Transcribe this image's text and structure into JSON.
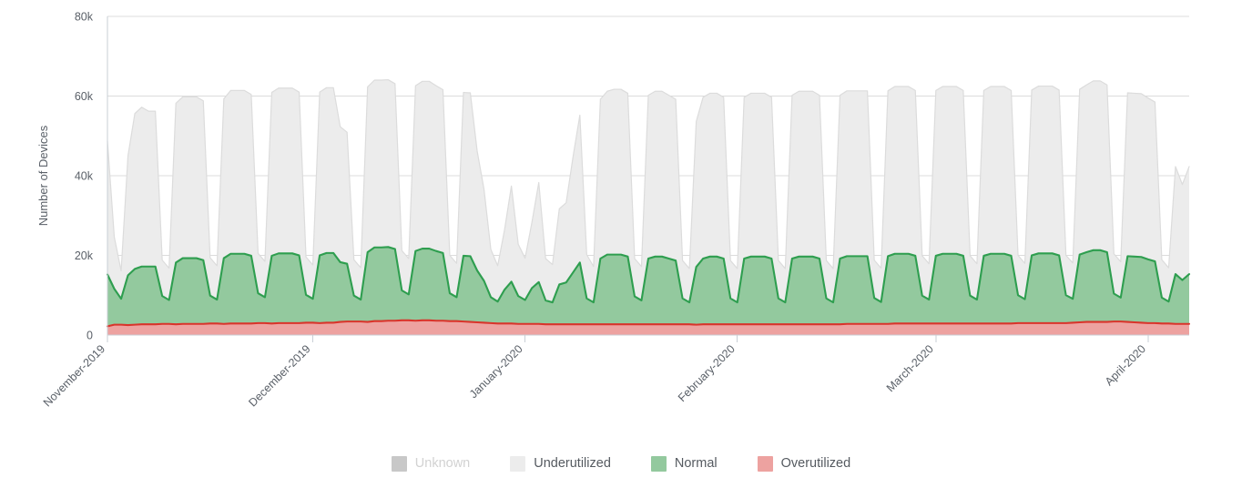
{
  "chart_data": {
    "type": "area",
    "stacked": true,
    "title": "",
    "subtitle": "",
    "xlabel": "",
    "ylabel": "Number of Devices",
    "ylim": [
      0,
      80000
    ],
    "yticks": [
      0,
      20000,
      40000,
      60000,
      80000
    ],
    "ytick_labels": [
      "0",
      "20k",
      "40k",
      "60k",
      "80k"
    ],
    "xtick_labels": [
      "November-2019",
      "December-2019",
      "January-2020",
      "February-2020",
      "March-2020",
      "April-2020"
    ],
    "xtick_rotation_deg": -45,
    "grid": "horizontal",
    "legend_position": "bottom",
    "x_range": [
      "2019-11-01",
      "2020-04-13"
    ],
    "x_interval": "daily",
    "series": [
      {
        "name": "Unknown",
        "fill_color": "#c8c8c8",
        "line_color": "#b4b4b4",
        "visible": false,
        "values": []
      },
      {
        "name": "Underutilized",
        "fill_color": "#ececec",
        "line_color": "#dcdcdc",
        "visible": true,
        "values": [
          33500,
          13000,
          7000,
          30000,
          39000,
          40000,
          39000,
          39000,
          9000,
          8000,
          40000,
          40500,
          40500,
          40500,
          40000,
          9500,
          8500,
          40000,
          41000,
          41000,
          41000,
          40500,
          10000,
          9000,
          41000,
          41500,
          41500,
          41500,
          41000,
          9500,
          8500,
          41000,
          41500,
          41500,
          34000,
          33000,
          9000,
          8000,
          41500,
          42000,
          42000,
          42000,
          41500,
          10000,
          9000,
          41500,
          42000,
          42000,
          41500,
          41000,
          9500,
          8500,
          41000,
          41000,
          30000,
          23000,
          12000,
          9000,
          15000,
          24000,
          13000,
          10500,
          16500,
          25000,
          10500,
          9500,
          19000,
          20000,
          29000,
          37000,
          11000,
          9000,
          40000,
          41000,
          41500,
          41500,
          41000,
          9500,
          8500,
          41000,
          41500,
          41500,
          41000,
          40500,
          9500,
          8500,
          36500,
          40500,
          41000,
          41000,
          40500,
          9500,
          8500,
          40500,
          41000,
          41000,
          41000,
          40500,
          9500,
          8500,
          41000,
          41500,
          41500,
          41500,
          41000,
          9500,
          8500,
          41000,
          41500,
          41500,
          41500,
          41500,
          9500,
          8500,
          41500,
          42000,
          42000,
          42000,
          41500,
          10000,
          9000,
          41500,
          42000,
          42000,
          42000,
          41500,
          10000,
          9000,
          41500,
          42000,
          42000,
          42000,
          41500,
          10000,
          9000,
          41500,
          42000,
          42000,
          42000,
          41500,
          10000,
          9000,
          41500,
          42000,
          42500,
          42500,
          42000,
          10000,
          9000,
          41000,
          41000,
          41000,
          40500,
          40000,
          9500,
          8500,
          27000,
          24000,
          27000
        ]
      },
      {
        "name": "Normal",
        "fill_color": "#93c99e",
        "line_color": "#2e9e4f",
        "visible": true,
        "values": [
          13000,
          9000,
          6500,
          12500,
          14000,
          14500,
          14500,
          14500,
          7000,
          6000,
          15500,
          16500,
          16500,
          16500,
          16000,
          7000,
          6000,
          16500,
          17500,
          17500,
          17500,
          17000,
          7500,
          6500,
          17000,
          17500,
          17500,
          17500,
          17000,
          7000,
          6000,
          17000,
          17500,
          17500,
          15000,
          14500,
          6500,
          5500,
          17500,
          18500,
          18500,
          18500,
          18000,
          7500,
          6500,
          17500,
          18000,
          18000,
          17500,
          17000,
          7000,
          6000,
          16500,
          16500,
          13000,
          10500,
          6500,
          5500,
          8500,
          10500,
          7000,
          6000,
          9000,
          10500,
          6000,
          5500,
          10000,
          10500,
          13000,
          15500,
          6500,
          5500,
          16500,
          17500,
          17500,
          17500,
          17000,
          7000,
          6000,
          16500,
          17000,
          17000,
          16500,
          16000,
          6500,
          5500,
          14500,
          16500,
          17000,
          17000,
          16500,
          6500,
          5500,
          16500,
          17000,
          17000,
          17000,
          16500,
          6500,
          5500,
          16500,
          17000,
          17000,
          17000,
          16500,
          6500,
          5500,
          16500,
          17000,
          17000,
          17000,
          17000,
          6500,
          5500,
          17000,
          17500,
          17500,
          17500,
          17000,
          7000,
          6000,
          17000,
          17500,
          17500,
          17500,
          17000,
          7000,
          6000,
          17000,
          17500,
          17500,
          17500,
          17000,
          7000,
          6000,
          17000,
          17500,
          17500,
          17500,
          17000,
          7000,
          6000,
          17000,
          17500,
          18000,
          18000,
          17500,
          7000,
          6000,
          16500,
          16500,
          16500,
          16000,
          15500,
          6500,
          5500,
          12500,
          11000,
          12500
        ]
      },
      {
        "name": "Overutilized",
        "fill_color": "#eda2a0",
        "line_color": "#d9342b",
        "visible": true,
        "values": [
          2200,
          2600,
          2600,
          2500,
          2600,
          2700,
          2700,
          2700,
          2800,
          2800,
          2700,
          2800,
          2800,
          2800,
          2800,
          2900,
          2900,
          2800,
          2900,
          2900,
          2900,
          2900,
          3000,
          3000,
          2900,
          3000,
          3000,
          3000,
          3000,
          3100,
          3100,
          3000,
          3100,
          3100,
          3300,
          3400,
          3400,
          3400,
          3300,
          3500,
          3500,
          3600,
          3600,
          3700,
          3700,
          3600,
          3700,
          3700,
          3600,
          3600,
          3500,
          3500,
          3400,
          3300,
          3200,
          3100,
          3000,
          2900,
          2900,
          2900,
          2800,
          2800,
          2800,
          2800,
          2700,
          2700,
          2700,
          2700,
          2700,
          2700,
          2700,
          2700,
          2700,
          2700,
          2700,
          2700,
          2700,
          2700,
          2700,
          2700,
          2700,
          2700,
          2700,
          2700,
          2700,
          2700,
          2600,
          2700,
          2700,
          2700,
          2700,
          2700,
          2700,
          2700,
          2700,
          2700,
          2700,
          2700,
          2700,
          2700,
          2700,
          2700,
          2700,
          2700,
          2700,
          2700,
          2700,
          2700,
          2800,
          2800,
          2800,
          2800,
          2800,
          2800,
          2800,
          2900,
          2900,
          2900,
          2900,
          2900,
          2900,
          2900,
          2900,
          2900,
          2900,
          2900,
          2900,
          2900,
          2900,
          2900,
          2900,
          2900,
          2900,
          3000,
          3000,
          3000,
          3000,
          3000,
          3000,
          3000,
          3000,
          3100,
          3200,
          3300,
          3300,
          3300,
          3300,
          3400,
          3400,
          3300,
          3200,
          3100,
          3000,
          3000,
          2900,
          2900,
          2800,
          2800,
          2800
        ]
      }
    ]
  },
  "axis": {
    "y_title": "Number of Devices"
  },
  "legend": {
    "items": [
      {
        "label": "Unknown",
        "color": "#c8c8c8",
        "disabled": true
      },
      {
        "label": "Underutilized",
        "color": "#ececec",
        "disabled": false
      },
      {
        "label": "Normal",
        "color": "#93c99e",
        "disabled": false
      },
      {
        "label": "Overutilized",
        "color": "#eda2a0",
        "disabled": false
      }
    ]
  }
}
